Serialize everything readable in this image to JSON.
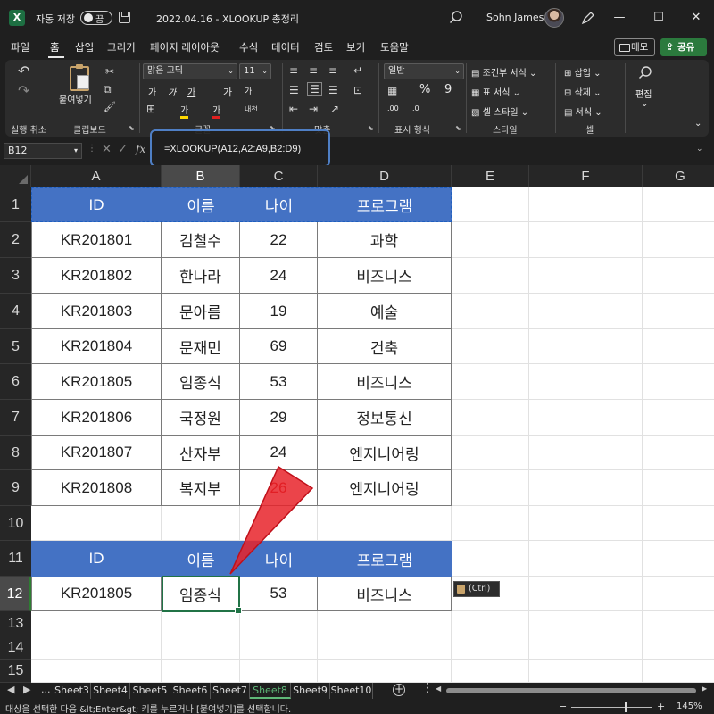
{
  "titlebar": {
    "app_logo": "X",
    "autosave_label": "자동 저장",
    "autosave_state": "끔",
    "doc_title": "2022.04.16 - XLOOKUP 총정리",
    "user_name": "Sohn James",
    "icons": [
      "excel-logo-icon",
      "save-icon",
      "search-icon",
      "avatar",
      "pen-icon",
      "minimize-icon",
      "maximize-icon",
      "close-icon"
    ],
    "minimize": "—",
    "maximize": "☐",
    "close": "✕"
  },
  "menu": {
    "tabs": [
      "파일",
      "홈",
      "삽입",
      "그리기",
      "페이지 레이아웃",
      "수식",
      "데이터",
      "검토",
      "보기",
      "도움말"
    ],
    "active": "홈",
    "memo_label": "메모",
    "share_label": "공유"
  },
  "ribbon": {
    "undo_group_label": "실행 취소",
    "undo_icon": "↶",
    "redo_icon": "↷",
    "clipboard_group_label": "클립보드",
    "paste_label": "붙여넣기",
    "cut_icon": "✂",
    "copy_icon": "⧉",
    "format_painter_icon": "🖌",
    "font_name": "맑은 고딕",
    "font_size": "11",
    "font_group_label": "글꼴",
    "font_grow": "가",
    "font_shrink": "가",
    "bold": "가",
    "italic": "가",
    "underline": "가",
    "fill_letter": "가",
    "font_color_letter": "가",
    "phonetic": "내천",
    "align_group_label": "맞춤",
    "number_group_label": "표시 형식",
    "number_format": "일반",
    "percent": "%",
    "comma": "9",
    "inc_decimal": ".00",
    "dec_decimal": ".0",
    "style_group_label": "스타일",
    "conditional_format": "조건부 서식",
    "format_as_table": "표 서식",
    "cell_styles": "셀 스타일",
    "cells_group_label": "셀",
    "insert": "삽입",
    "delete": "삭제",
    "format": "서식",
    "editing_label": "편집",
    "dropdown_glyph": "⌄"
  },
  "formula_bar": {
    "name_box": "B12",
    "fx_label": "fx",
    "cancel": "✕",
    "enter": "✓",
    "dots": "⋮",
    "formula": "=XLOOKUP(A12,A2:A9,B2:D9)",
    "expand": "⌄"
  },
  "grid": {
    "columns": [
      "A",
      "B",
      "C",
      "D",
      "E",
      "F",
      "G"
    ],
    "selected_column": "B",
    "rows": [
      "1",
      "2",
      "3",
      "4",
      "5",
      "6",
      "7",
      "8",
      "9",
      "10",
      "11",
      "12",
      "13",
      "14",
      "15"
    ],
    "selected_row": "12",
    "table_headers": [
      "ID",
      "이름",
      "나이",
      "프로그램"
    ],
    "table_rows": [
      [
        "KR201801",
        "김철수",
        "22",
        "과학"
      ],
      [
        "KR201802",
        "한나라",
        "24",
        "비즈니스"
      ],
      [
        "KR201803",
        "문아름",
        "19",
        "예술"
      ],
      [
        "KR201804",
        "문재민",
        "69",
        "건축"
      ],
      [
        "KR201805",
        "임종식",
        "53",
        "비즈니스"
      ],
      [
        "KR201806",
        "국정원",
        "29",
        "정보통신"
      ],
      [
        "KR201807",
        "산자부",
        "24",
        "엔지니어링"
      ],
      [
        "KR201808",
        "복지부",
        "26",
        "엔지니어링"
      ]
    ],
    "lookup_headers": [
      "ID",
      "이름",
      "나이",
      "프로그램"
    ],
    "lookup_row": [
      "KR201805",
      "임종식",
      "53",
      "비즈니스"
    ],
    "paste_options_label": "(Ctrl)",
    "annotation_color": "#e8232a"
  },
  "sheets": {
    "nav_prev": "◀",
    "nav_next": "▶",
    "ellipsis": "...",
    "tabs": [
      "Sheet3",
      "Sheet4",
      "Sheet5",
      "Sheet6",
      "Sheet7",
      "Sheet8",
      "Sheet9",
      "Sheet10"
    ],
    "active": "Sheet8",
    "add_icon": "+"
  },
  "status": {
    "message": "대상을 선택한 다음 &lt;Enter&gt; 키를 누르거나 [붙여넣기]를 선택합니다.",
    "zoom_minus": "−",
    "zoom_plus": "+",
    "zoom": "145%"
  },
  "colors": {
    "header_fill": "#4472c4",
    "active_cell": "#217346",
    "share_button": "#2b7a3d",
    "active_sheet": "#5fb878"
  }
}
